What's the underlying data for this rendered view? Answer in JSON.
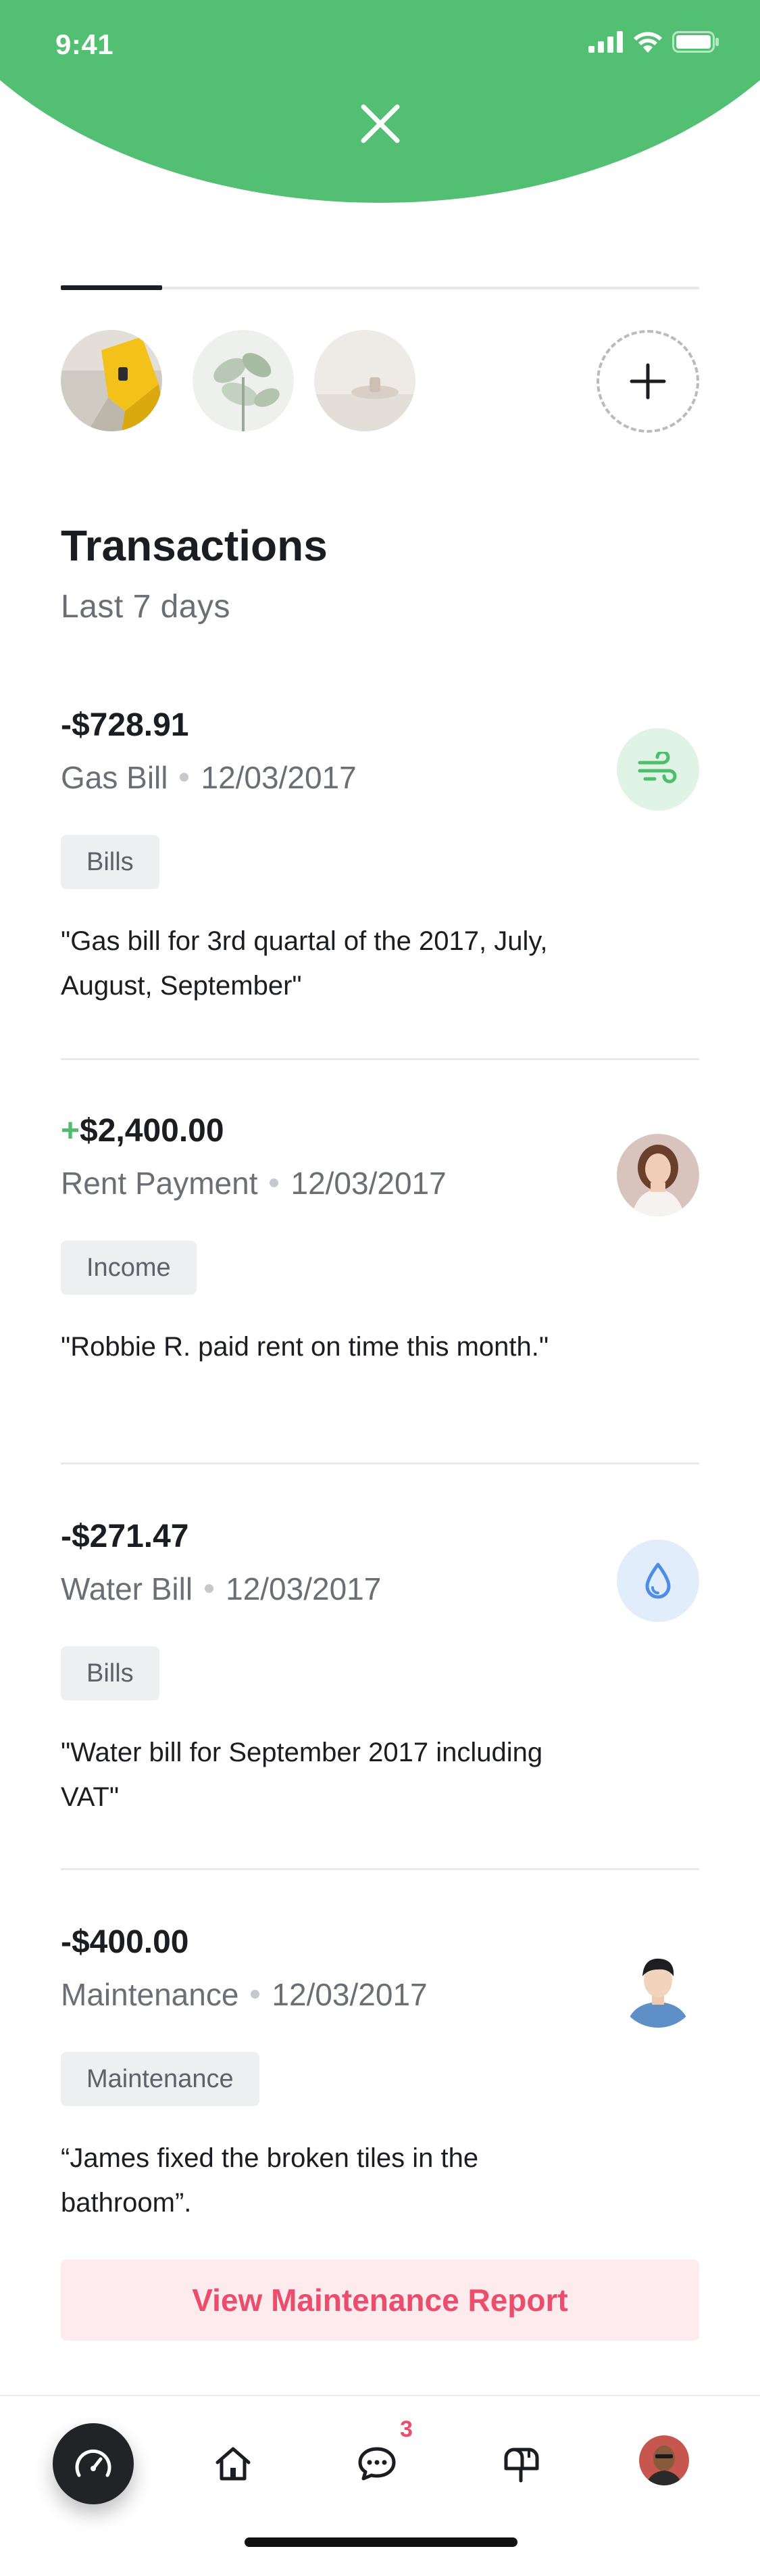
{
  "status_bar": {
    "time": "9:41"
  },
  "section": {
    "title": "Transactions",
    "subtitle": "Last 7 days"
  },
  "transactions": [
    {
      "sign": "-",
      "amount": "$728.91",
      "title": "Gas Bill",
      "date": "12/03/2017",
      "tag": "Bills",
      "note": "\"Gas bill for 3rd quartal of the 2017, July, August, September\"",
      "icon": "wind-icon",
      "icon_color": "#4cbe6c",
      "icon_bg": "#dff4e5"
    },
    {
      "sign": "+",
      "amount": "$2,400.00",
      "title": "Rent Payment",
      "date": "12/03/2017",
      "tag": "Income",
      "note": "\"Robbie R. paid rent on time this month.\"",
      "icon": "tenant-avatar",
      "icon_color": "#4cbe6c"
    },
    {
      "sign": "-",
      "amount": "$271.47",
      "title": "Water Bill",
      "date": "12/03/2017",
      "tag": "Bills",
      "note": "\"Water bill for September 2017 including VAT\"",
      "icon": "water-drop-icon",
      "icon_color": "#4d8de8",
      "icon_bg": "#e2edfc"
    },
    {
      "sign": "-",
      "amount": "$400.00",
      "title": "Maintenance",
      "date": "12/03/2017",
      "tag": "Maintenance",
      "note": "“James fixed the broken tiles in the bathroom”.",
      "icon": "handyman-avatar"
    }
  ],
  "report_button": {
    "label": "View Maintenance Report",
    "color": "#ec4d6c",
    "bg": "#fdebee"
  },
  "nav": {
    "messages_badge": "3"
  },
  "colors": {
    "brand_green": "#53bf73",
    "text_dark": "#1c1d22",
    "text_muted": "#6c6e75",
    "accent_pink": "#ec4d6c"
  }
}
